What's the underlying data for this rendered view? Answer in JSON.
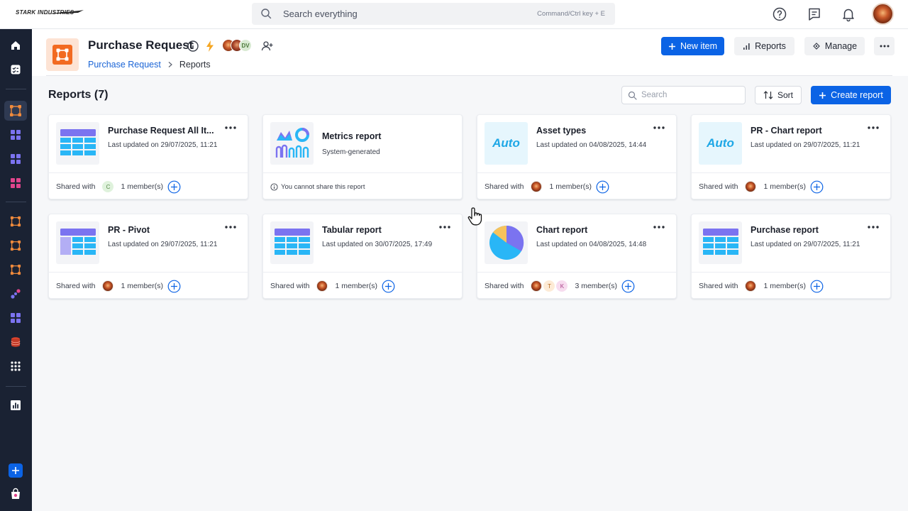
{
  "topbar": {
    "logo": "STARK INDUSTRIES",
    "search_label": "Search everything",
    "search_hint": "Command/Ctrl key + E"
  },
  "header": {
    "title": "Purchase Request",
    "breadcrumb": {
      "root": "Purchase Request",
      "current": "Reports"
    },
    "avatar_initials": "DV",
    "buttons": {
      "new_item": "New item",
      "reports": "Reports",
      "manage": "Manage"
    }
  },
  "reports": {
    "heading": "Reports (7)",
    "search_placeholder": "Search",
    "sort_label": "Sort",
    "create_label": "Create report",
    "shared_label": "Shared with",
    "cards": [
      {
        "title": "Purchase Request All It...",
        "meta": "Last updated on 29/07/2025, 11:21",
        "members": "1 member(s)",
        "avatars": [
          "C"
        ]
      },
      {
        "title": "Metrics report",
        "meta": "System-generated",
        "note": "You cannot share this report"
      },
      {
        "title": "Asset types",
        "meta": "Last updated on 04/08/2025, 14:44",
        "members": "1 member(s)",
        "thumb_text": "Auto"
      },
      {
        "title": "PR - Chart report",
        "meta": "Last updated on 29/07/2025, 11:21",
        "members": "1 member(s)",
        "thumb_text": "Auto"
      },
      {
        "title": "PR - Pivot",
        "meta": "Last updated on 29/07/2025, 11:21",
        "members": "1 member(s)"
      },
      {
        "title": "Tabular report",
        "meta": "Last updated on 30/07/2025, 17:49",
        "members": "1 member(s)"
      },
      {
        "title": "Chart report",
        "meta": "Last updated on 04/08/2025, 14:48",
        "members": "3 member(s)",
        "avatars": [
          "T",
          "K"
        ]
      },
      {
        "title": "Purchase report",
        "meta": "Last updated on 29/07/2025, 11:21",
        "members": "1 member(s)"
      }
    ]
  },
  "colors": {
    "primary": "#0b63e5",
    "nav_bg": "#1a2233",
    "app_accent": "#f26a21"
  }
}
